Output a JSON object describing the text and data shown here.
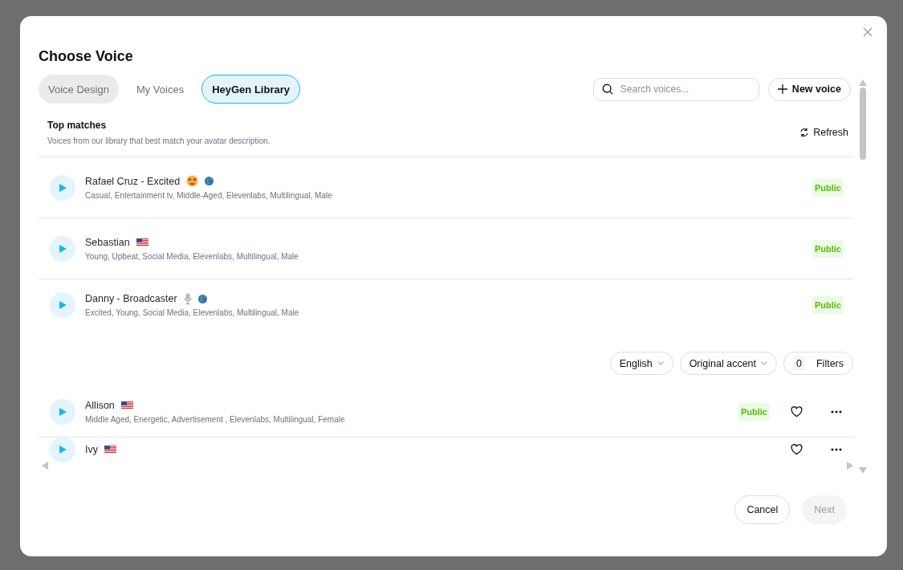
{
  "dialog": {
    "title": "Choose Voice"
  },
  "tabs": [
    {
      "label": "Voice Design",
      "selected": false,
      "kind": "filled"
    },
    {
      "label": "My Voices",
      "selected": false,
      "kind": "plain"
    },
    {
      "label": "HeyGen Library",
      "selected": true,
      "kind": "plain"
    }
  ],
  "search": {
    "placeholder": "Search voices..."
  },
  "new_voice_button": "New voice",
  "top_matches": {
    "title": "Top matches",
    "subtitle": "Voices from our library that best match your avatar description.",
    "refresh": "Refresh",
    "voices": [
      {
        "name": "Rafael Cruz - Excited",
        "emojis": [
          {
            "kind": "star-struck"
          },
          {
            "kind": "globe"
          }
        ],
        "tags": "Casual, Entertainment tv, Middle-Aged, Elevenlabs, Multilingual, Male",
        "badge": "Public"
      },
      {
        "name": "Sebastian",
        "emojis": [
          {
            "kind": "us-flag"
          }
        ],
        "tags": "Young, Upbeat, Social Media, Elevenlabs, Multilingual, Male",
        "badge": "Public"
      },
      {
        "name": "Danny - Broadcaster",
        "emojis": [
          {
            "kind": "microphone"
          },
          {
            "kind": "globe"
          }
        ],
        "tags": "Excited, Young, Social Media, Elevenlabs, Multilingual, Male",
        "badge": "Public"
      }
    ]
  },
  "filters": {
    "language": "English",
    "accent": "Original accent",
    "count": "0",
    "label": "Filters"
  },
  "library": [
    {
      "name": "Allison",
      "emojis": [
        {
          "kind": "us-flag"
        }
      ],
      "tags": "Middle Aged, Energetic, Advertisement , Elevenlabs, Multilingual, Female",
      "badge": "Public"
    },
    {
      "name": "Ivy",
      "emojis": [
        {
          "kind": "us-flag"
        }
      ]
    }
  ],
  "footer": {
    "cancel": "Cancel",
    "next": "Next",
    "next_disabled": true
  }
}
